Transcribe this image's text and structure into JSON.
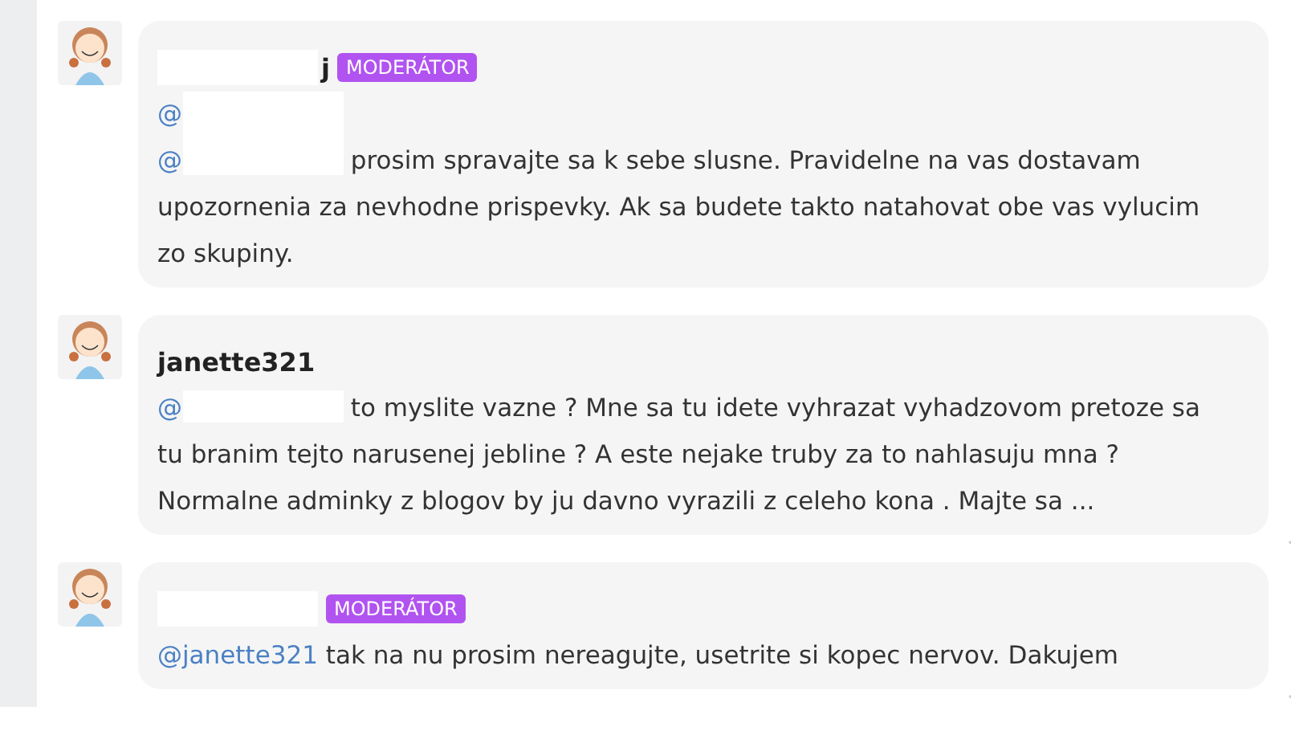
{
  "posts": [
    {
      "author": "j",
      "author_redacted": true,
      "badge": "MODERÁTOR",
      "paragraphs": [
        [
          {
            "kind": "mention",
            "text": "@"
          },
          {
            "kind": "redacted_tall"
          }
        ],
        [
          {
            "kind": "mention",
            "text": "@"
          },
          {
            "kind": "redacted"
          },
          {
            "kind": "text",
            "text": " prosim spravajte sa k sebe slusne. Pravidelne na vas dostavam upozornenia za nevhodne prispevky. Ak sa budete takto natahovat obe vas vylucim zo skupiny."
          }
        ]
      ],
      "expand": false
    },
    {
      "author": "janette321",
      "author_redacted": false,
      "paragraphs": [
        [
          {
            "kind": "mention",
            "text": "@"
          },
          {
            "kind": "redacted"
          },
          {
            "kind": "text",
            "text": " to myslite vazne ? Mne sa tu idete vyhrazat vyhadzovom pretoze sa tu branim tejto narusenej jebline ? A este nejake truby za to nahlasuju mna ? Normalne adminky z blogov by ju davno vyrazili z celeho kona . Majte sa ..."
          }
        ]
      ],
      "expand": true
    },
    {
      "author_redacted": true,
      "badge": "MODERÁTOR",
      "paragraphs": [
        [
          {
            "kind": "mention",
            "text": "@janette321"
          },
          {
            "kind": "text",
            "text": " tak na nu prosim nereagujte, usetrite si kopec nervov. Dakujem"
          }
        ]
      ],
      "expand": true
    }
  ]
}
